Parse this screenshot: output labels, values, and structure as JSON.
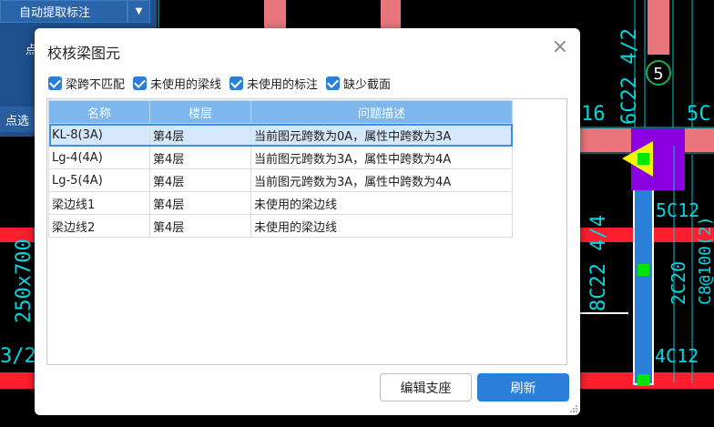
{
  "toolbar": {
    "auto_extract_label": "自动提取标注",
    "dropdown_arrow": "▼",
    "partial_button_label": "点",
    "point_select_label": "点选"
  },
  "cad": {
    "labels": {
      "rebar_top_vertical": "6C22 4/2",
      "axis_marker": "5",
      "left_16": "16",
      "right_5C": "5C",
      "c12_right": "5C12",
      "lower_rebar": "8C22 4/4",
      "c20": "2C20",
      "c8": "C8@100(2)",
      "c12_bottom": "4C12",
      "beam_section": "250x700",
      "bottom_left": "3/2"
    },
    "colors": {
      "beam_red": "#ff1e2d",
      "column_pink": "#e9767f",
      "blue_beam": "#2a7fd8",
      "purple_block": "#8a00e0",
      "yellow": "#f7f200",
      "green": "#00e600",
      "cyan_text": "#00d9e0"
    }
  },
  "dialog": {
    "title": "校核梁图元",
    "close_icon": "×",
    "filters": [
      {
        "label": "梁跨不匹配",
        "checked": true
      },
      {
        "label": "未使用的梁线",
        "checked": true
      },
      {
        "label": "未使用的标注",
        "checked": true
      },
      {
        "label": "缺少截面",
        "checked": true
      }
    ],
    "columns": [
      "名称",
      "楼层",
      "问题描述"
    ],
    "rows": [
      {
        "name": "KL-8(3A)",
        "floor": "第4层",
        "desc": "当前图元跨数为0A，属性中跨数为3A",
        "selected": true
      },
      {
        "name": "Lg-4(4A)",
        "floor": "第4层",
        "desc": "当前图元跨数为3A，属性中跨数为4A",
        "selected": false
      },
      {
        "name": "Lg-5(4A)",
        "floor": "第4层",
        "desc": "当前图元跨数为3A，属性中跨数为4A",
        "selected": false
      },
      {
        "name": "梁边线1",
        "floor": "第4层",
        "desc": "未使用的梁边线",
        "selected": false
      },
      {
        "name": "梁边线2",
        "floor": "第4层",
        "desc": "未使用的梁边线",
        "selected": false
      }
    ],
    "edit_support_label": "编辑支座",
    "refresh_label": "刷新"
  }
}
